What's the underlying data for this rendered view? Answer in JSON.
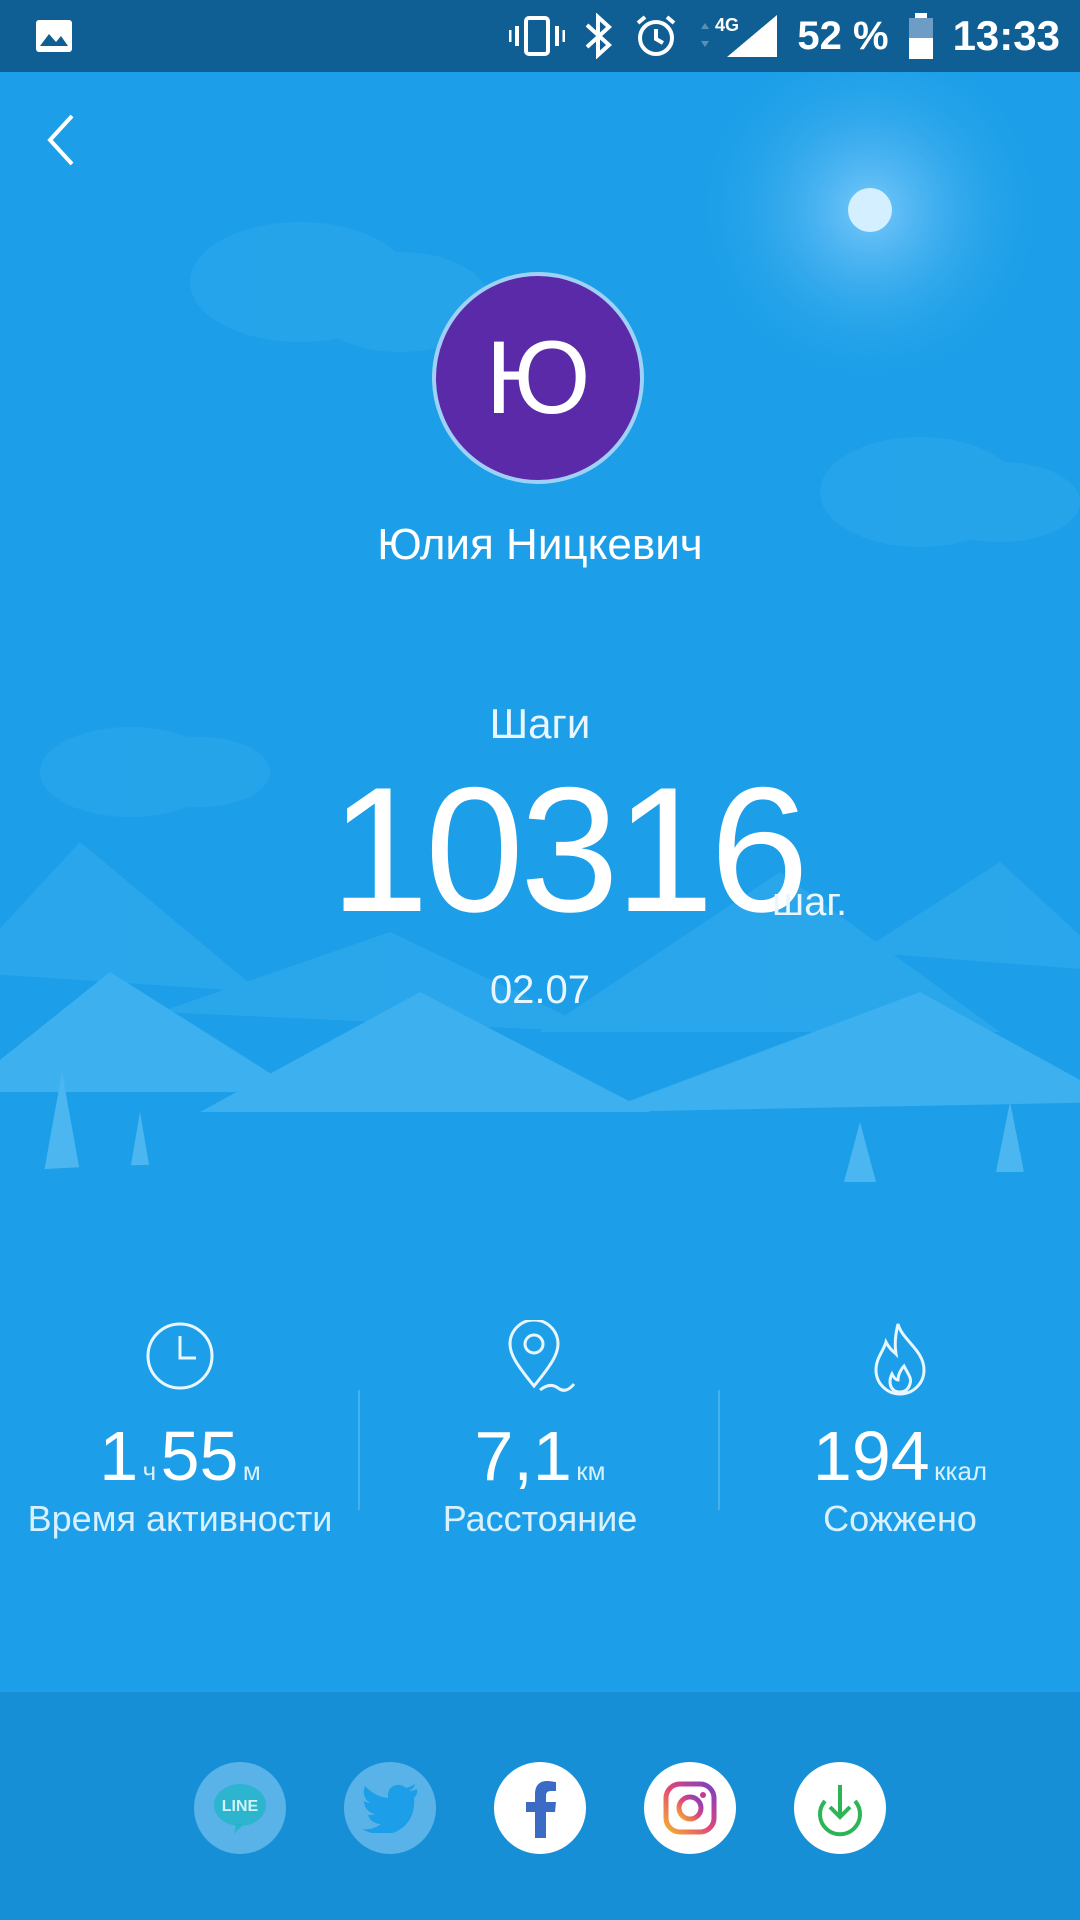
{
  "status_bar": {
    "signal_type": "4G",
    "battery": "52 %",
    "time": "13:33",
    "icons": [
      "image-icon",
      "vibrate-icon",
      "bluetooth-icon",
      "alarm-icon",
      "signal-icon",
      "battery-icon"
    ]
  },
  "profile": {
    "avatar_initial": "Ю",
    "name": "Юлия Ницкевич"
  },
  "steps": {
    "label": "Шаги",
    "value": "10316",
    "unit": "шаг.",
    "date": "02.07"
  },
  "stats": [
    {
      "icon": "clock-icon",
      "value_parts": [
        "1",
        "ч",
        "55",
        "м"
      ],
      "label": "Время активности"
    },
    {
      "icon": "location-pin-icon",
      "value": "7,1",
      "unit": "км",
      "label": "Расстояние"
    },
    {
      "icon": "flame-icon",
      "value": "194",
      "unit": "ккал",
      "label": "Сожжено"
    }
  ],
  "share": [
    {
      "name": "LINE",
      "label": "LINE",
      "color": "#1fb4c7"
    },
    {
      "name": "Twitter",
      "color": "#6ec3f5"
    },
    {
      "name": "Facebook",
      "color": "#3b6bc4"
    },
    {
      "name": "Instagram",
      "color": "#e0467a"
    },
    {
      "name": "Download",
      "color": "#2db555"
    }
  ],
  "colors": {
    "background": "#1c9fe8",
    "status_bar": "#0f5f94",
    "avatar": "#5a2aa8",
    "bottom_bar": "#168fd6"
  }
}
